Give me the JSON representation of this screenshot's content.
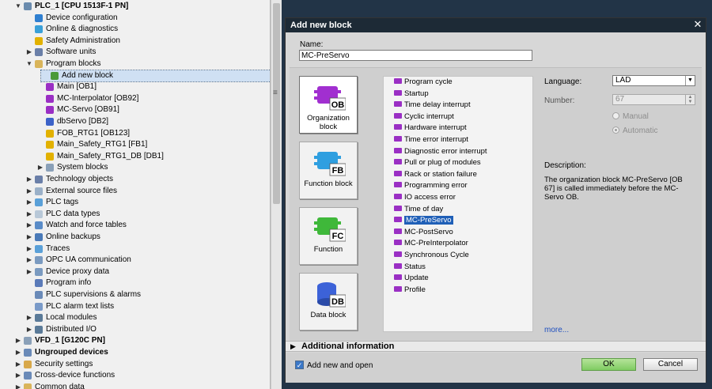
{
  "tree": {
    "items": [
      {
        "label": "PLC_1 [CPU 1513F-1 PN]",
        "arrow": "▼",
        "icon": "plc-icon",
        "color": "#6b8cae",
        "bold": true
      },
      {
        "label": "Device configuration",
        "arrow": "",
        "icon": "device-configuration-icon",
        "color": "#2f7fd0",
        "bold": false
      },
      {
        "label": "Online & diagnostics",
        "arrow": "",
        "icon": "online-diagnostics-icon",
        "color": "#3aa0d8",
        "bold": false
      },
      {
        "label": "Safety Administration",
        "arrow": "",
        "icon": "safety-icon",
        "color": "#e2b100",
        "bold": false
      },
      {
        "label": "Software units",
        "arrow": "▶",
        "icon": "software-units-icon",
        "color": "#6a7fa8",
        "bold": false
      },
      {
        "label": "Program blocks",
        "arrow": "▼",
        "icon": "folder-icon",
        "color": "#d9b45a",
        "bold": false
      },
      {
        "label": "Add new block",
        "arrow": "",
        "icon": "add-block-icon",
        "color": "#4a9a3a",
        "bold": false,
        "selected": true
      },
      {
        "label": "Main [OB1]",
        "arrow": "",
        "icon": "ob-icon",
        "color": "#9a2fc4",
        "bold": false
      },
      {
        "label": "MC-Interpolator [OB92]",
        "arrow": "",
        "icon": "ob-icon",
        "color": "#9a2fc4",
        "bold": false
      },
      {
        "label": "MC-Servo [OB91]",
        "arrow": "",
        "icon": "ob-icon",
        "color": "#9a2fc4",
        "bold": false
      },
      {
        "label": "dbServo [DB2]",
        "arrow": "",
        "icon": "db-icon",
        "color": "#3c62c8",
        "bold": false
      },
      {
        "label": "FOB_RTG1 [OB123]",
        "arrow": "",
        "icon": "fob-icon",
        "color": "#e2b100",
        "bold": false
      },
      {
        "label": "Main_Safety_RTG1 [FB1]",
        "arrow": "",
        "icon": "fb-safety-icon",
        "color": "#e2b100",
        "bold": false
      },
      {
        "label": "Main_Safety_RTG1_DB [DB1]",
        "arrow": "",
        "icon": "db-safety-icon",
        "color": "#e2b100",
        "bold": false
      },
      {
        "label": "System blocks",
        "arrow": "▶",
        "icon": "system-blocks-icon",
        "color": "#8aa0b8",
        "bold": false
      },
      {
        "label": "Technology objects",
        "arrow": "▶",
        "icon": "technology-objects-icon",
        "color": "#6a7fa8",
        "bold": false
      },
      {
        "label": "External source files",
        "arrow": "▶",
        "icon": "external-source-icon",
        "color": "#9ab0c8",
        "bold": false
      },
      {
        "label": "PLC tags",
        "arrow": "▶",
        "icon": "plc-tags-icon",
        "color": "#5aa0d8",
        "bold": false
      },
      {
        "label": "PLC data types",
        "arrow": "▶",
        "icon": "plc-data-types-icon",
        "color": "#b8c8d8",
        "bold": false
      },
      {
        "label": "Watch and force tables",
        "arrow": "▶",
        "icon": "watch-tables-icon",
        "color": "#5a8cc8",
        "bold": false
      },
      {
        "label": "Online backups",
        "arrow": "▶",
        "icon": "online-backups-icon",
        "color": "#4a7ab8",
        "bold": false
      },
      {
        "label": "Traces",
        "arrow": "▶",
        "icon": "traces-icon",
        "color": "#5aa0d8",
        "bold": false
      },
      {
        "label": "OPC UA communication",
        "arrow": "▶",
        "icon": "opc-ua-icon",
        "color": "#7a9ac0",
        "bold": false
      },
      {
        "label": "Device proxy data",
        "arrow": "▶",
        "icon": "device-proxy-icon",
        "color": "#7a9ac0",
        "bold": false
      },
      {
        "label": "Program info",
        "arrow": "",
        "icon": "program-info-icon",
        "color": "#5a7ab8",
        "bold": false
      },
      {
        "label": "PLC supervisions & alarms",
        "arrow": "",
        "icon": "plc-alarms-icon",
        "color": "#6a8ab8",
        "bold": false
      },
      {
        "label": "PLC alarm text lists",
        "arrow": "",
        "icon": "alarm-text-lists-icon",
        "color": "#7a9ac8",
        "bold": false
      },
      {
        "label": "Local modules",
        "arrow": "▶",
        "icon": "local-modules-icon",
        "color": "#5a7a98",
        "bold": false
      },
      {
        "label": "Distributed I/O",
        "arrow": "▶",
        "icon": "distributed-io-icon",
        "color": "#5a7a98",
        "bold": false
      },
      {
        "label": "VFD_1 [G120C PN]",
        "arrow": "▶",
        "icon": "drive-icon",
        "color": "#8aa0b8",
        "bold": true
      },
      {
        "label": "Ungrouped devices",
        "arrow": "▶",
        "icon": "ungrouped-devices-icon",
        "color": "#6a8ab8",
        "bold": true
      },
      {
        "label": "Security settings",
        "arrow": "▶",
        "icon": "security-settings-icon",
        "color": "#d8a84a",
        "bold": false
      },
      {
        "label": "Cross-device functions",
        "arrow": "▶",
        "icon": "cross-device-icon",
        "color": "#6a8ab8",
        "bold": false
      },
      {
        "label": "Common data",
        "arrow": "▶",
        "icon": "common-data-icon",
        "color": "#d9b45a",
        "bold": false
      }
    ]
  },
  "dialog": {
    "title": "Add new block",
    "close": "✕",
    "name_label": "Name:",
    "name_value": "MC-PreServo",
    "block_types": [
      {
        "label": "Organization block",
        "code": "OB",
        "color": "#a12fd0",
        "active": true
      },
      {
        "label": "Function block",
        "code": "FB",
        "color": "#2f9fe0",
        "active": false
      },
      {
        "label": "Function",
        "code": "FC",
        "color": "#3fb83a",
        "active": false
      },
      {
        "label": "Data block",
        "code": "DB",
        "color": "#3c62d8",
        "active": false
      }
    ],
    "ob_types": [
      {
        "label": "Program cycle",
        "selected": false
      },
      {
        "label": "Startup",
        "selected": false
      },
      {
        "label": "Time delay interrupt",
        "selected": false
      },
      {
        "label": "Cyclic interrupt",
        "selected": false
      },
      {
        "label": "Hardware interrupt",
        "selected": false
      },
      {
        "label": "Time error interrupt",
        "selected": false
      },
      {
        "label": "Diagnostic error interrupt",
        "selected": false
      },
      {
        "label": "Pull or plug of modules",
        "selected": false
      },
      {
        "label": "Rack or station failure",
        "selected": false
      },
      {
        "label": "Programming error",
        "selected": false
      },
      {
        "label": "IO access error",
        "selected": false
      },
      {
        "label": "Time of day",
        "selected": false
      },
      {
        "label": "MC-PreServo",
        "selected": true
      },
      {
        "label": "MC-PostServo",
        "selected": false
      },
      {
        "label": "MC-PreInterpolator",
        "selected": false
      },
      {
        "label": "Synchronous Cycle",
        "selected": false
      },
      {
        "label": "Status",
        "selected": false
      },
      {
        "label": "Update",
        "selected": false
      },
      {
        "label": "Profile",
        "selected": false
      }
    ],
    "language_label": "Language:",
    "language_value": "LAD",
    "number_label": "Number:",
    "number_value": "67",
    "manual_label": "Manual",
    "automatic_label": "Automatic",
    "description_label": "Description:",
    "description_text": "The organization block MC-PreServo [OB 67] is called immediately before the MC-Servo OB.",
    "more_label": "more...",
    "additional_info_label": "Additional information",
    "add_new_and_open_label": "Add new and open",
    "add_new_and_open_checked": true,
    "ok_label": "OK",
    "cancel_label": "Cancel"
  }
}
